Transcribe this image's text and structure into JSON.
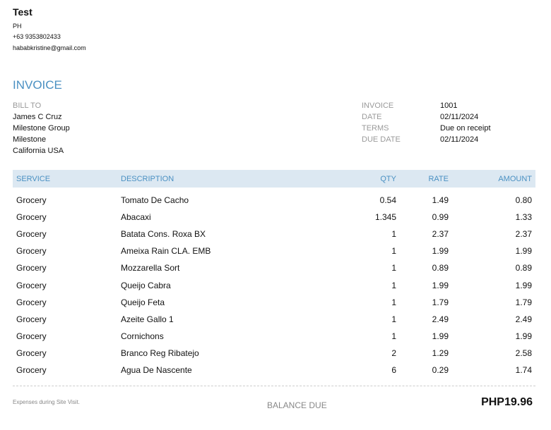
{
  "company": {
    "name": "Test",
    "country": "PH",
    "phone": "+63 9353802433",
    "email": "hababkristine@gmail.com"
  },
  "title": "INVOICE",
  "bill_to": {
    "label": "BILL TO",
    "lines": [
      "James C Cruz",
      "Milestone Group",
      "Milestone",
      "California USA"
    ]
  },
  "meta": [
    {
      "label": "INVOICE",
      "value": "1001"
    },
    {
      "label": "DATE",
      "value": "02/11/2024"
    },
    {
      "label": "TERMS",
      "value": "Due on receipt"
    },
    {
      "label": "DUE DATE",
      "value": "02/11/2024"
    }
  ],
  "table": {
    "headers": {
      "service": "SERVICE",
      "description": "DESCRIPTION",
      "qty": "QTY",
      "rate": "RATE",
      "amount": "AMOUNT"
    },
    "rows": [
      {
        "service": "Grocery",
        "description": "Tomato De Cacho",
        "qty": "0.54",
        "rate": "1.49",
        "amount": "0.80"
      },
      {
        "service": "Grocery",
        "description": "Abacaxi",
        "qty": "1.345",
        "rate": "0.99",
        "amount": "1.33"
      },
      {
        "service": "Grocery",
        "description": "Batata Cons. Roxa BX",
        "qty": "1",
        "rate": "2.37",
        "amount": "2.37"
      },
      {
        "service": "Grocery",
        "description": "Ameixa Rain CLA. EMB",
        "qty": "1",
        "rate": "1.99",
        "amount": "1.99"
      },
      {
        "service": "Grocery",
        "description": "Mozzarella Sort",
        "qty": "1",
        "rate": "0.89",
        "amount": "0.89"
      },
      {
        "service": "Grocery",
        "description": "Queijo Cabra",
        "qty": "1",
        "rate": "1.99",
        "amount": "1.99"
      },
      {
        "service": "Grocery",
        "description": "Queijo Feta",
        "qty": "1",
        "rate": "1.79",
        "amount": "1.79"
      },
      {
        "service": "Grocery",
        "description": "Azeite Gallo 1",
        "qty": "1",
        "rate": "2.49",
        "amount": "2.49"
      },
      {
        "service": "Grocery",
        "description": "Cornichons",
        "qty": "1",
        "rate": "1.99",
        "amount": "1.99"
      },
      {
        "service": "Grocery",
        "description": "Branco Reg Ribatejo",
        "qty": "2",
        "rate": "1.29",
        "amount": "2.58"
      },
      {
        "service": "Grocery",
        "description": "Agua De Nascente",
        "qty": "6",
        "rate": "0.29",
        "amount": "1.74"
      }
    ]
  },
  "footer": {
    "note": "Expenses during Site Visit.",
    "balance_label": "BALANCE DUE",
    "balance_value": "PHP19.96"
  }
}
